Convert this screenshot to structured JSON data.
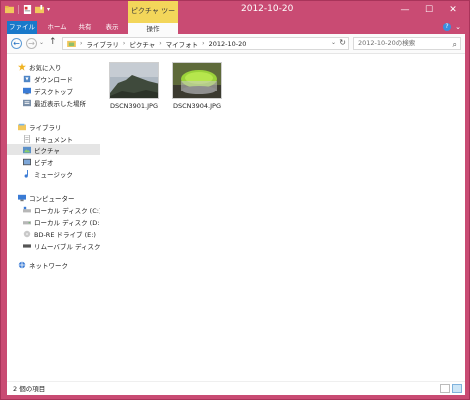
{
  "window": {
    "title": "2012-10-20",
    "context_tab_group": "ピクチャ ツール",
    "buttons": {
      "minimize": "—",
      "maximize": "☐",
      "close": "✕"
    }
  },
  "ribbon": {
    "tabs": [
      "ファイル",
      "ホーム",
      "共有",
      "表示",
      "操作"
    ],
    "collapse_symbol": "⌄",
    "help_symbol": "?"
  },
  "nav": {
    "back": "←",
    "forward": "→",
    "recent": "⌄",
    "up": "↑"
  },
  "address": {
    "breadcrumbs": [
      "ライブラリ",
      "ピクチャ",
      "マイフォト",
      "2012-10-20"
    ],
    "sep": "›",
    "dropdown": "⌄",
    "refresh": "↻"
  },
  "search": {
    "placeholder": "2012-10-20の検索",
    "icon": "⌕"
  },
  "sidebar": {
    "favorites": {
      "label": "お気に入り",
      "items": [
        "ダウンロード",
        "デスクトップ",
        "最近表示した場所"
      ]
    },
    "libraries": {
      "label": "ライブラリ",
      "items": [
        "ドキュメント",
        "ピクチャ",
        "ビデオ",
        "ミュージック"
      ]
    },
    "computer": {
      "label": "コンピューター",
      "items": [
        "ローカル ディスク (C:)",
        "ローカル ディスク (D:)",
        "BD-RE ドライブ (E:)",
        "リムーバブル ディスク (F"
      ]
    },
    "network": {
      "label": "ネットワーク"
    }
  },
  "files": [
    {
      "name": "DSCN3901.JPG"
    },
    {
      "name": "DSCN3904.JPG"
    }
  ],
  "status": {
    "count_text": "2 個の項目"
  },
  "colors": {
    "frame": "#c94b73",
    "file_tab": "#1979ca",
    "context_tab": "#f3d65a",
    "selected_nav": "#e5e5e5"
  }
}
